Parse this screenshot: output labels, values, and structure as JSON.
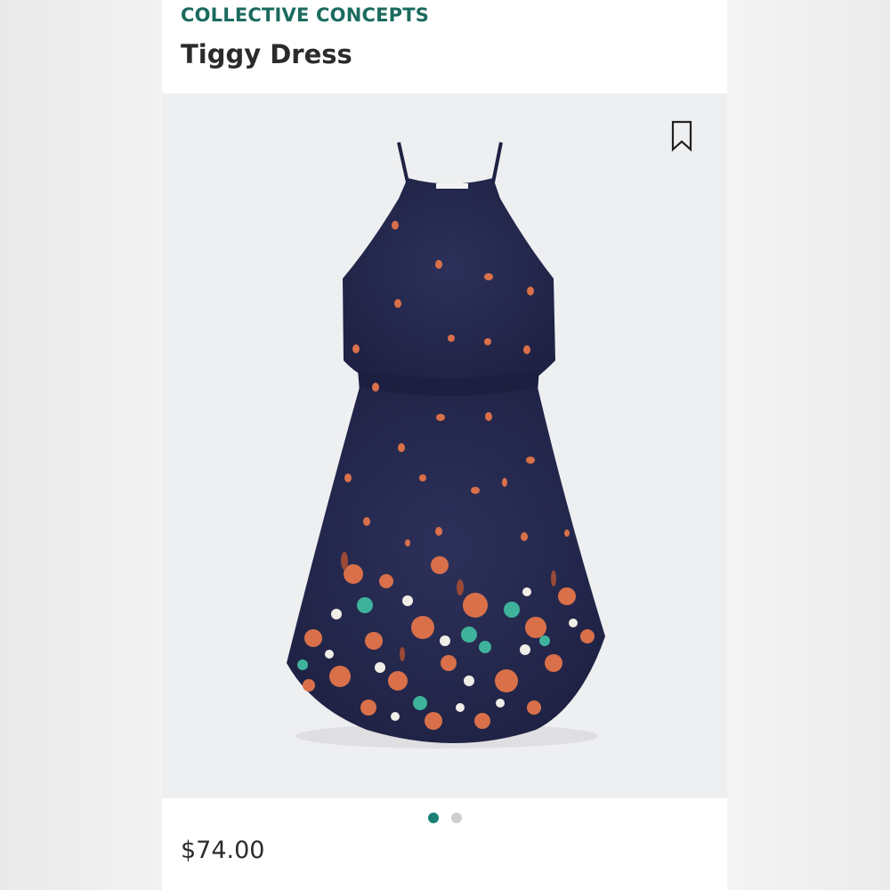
{
  "product": {
    "brand": "COLLECTIVE CONCEPTS",
    "name": "Tiggy Dress",
    "price": "$74.00"
  },
  "gallery": {
    "image_count": 2,
    "active_index": 0
  },
  "icons": {
    "bookmark": "bookmark-icon"
  },
  "colors": {
    "brand_text": "#1a6b5e",
    "active_dot": "#1a7f74",
    "inactive_dot": "#cfcfcf",
    "dress_navy": "#272a4e",
    "petal_coral": "#d9704a",
    "leaf_teal": "#3fb29c"
  }
}
